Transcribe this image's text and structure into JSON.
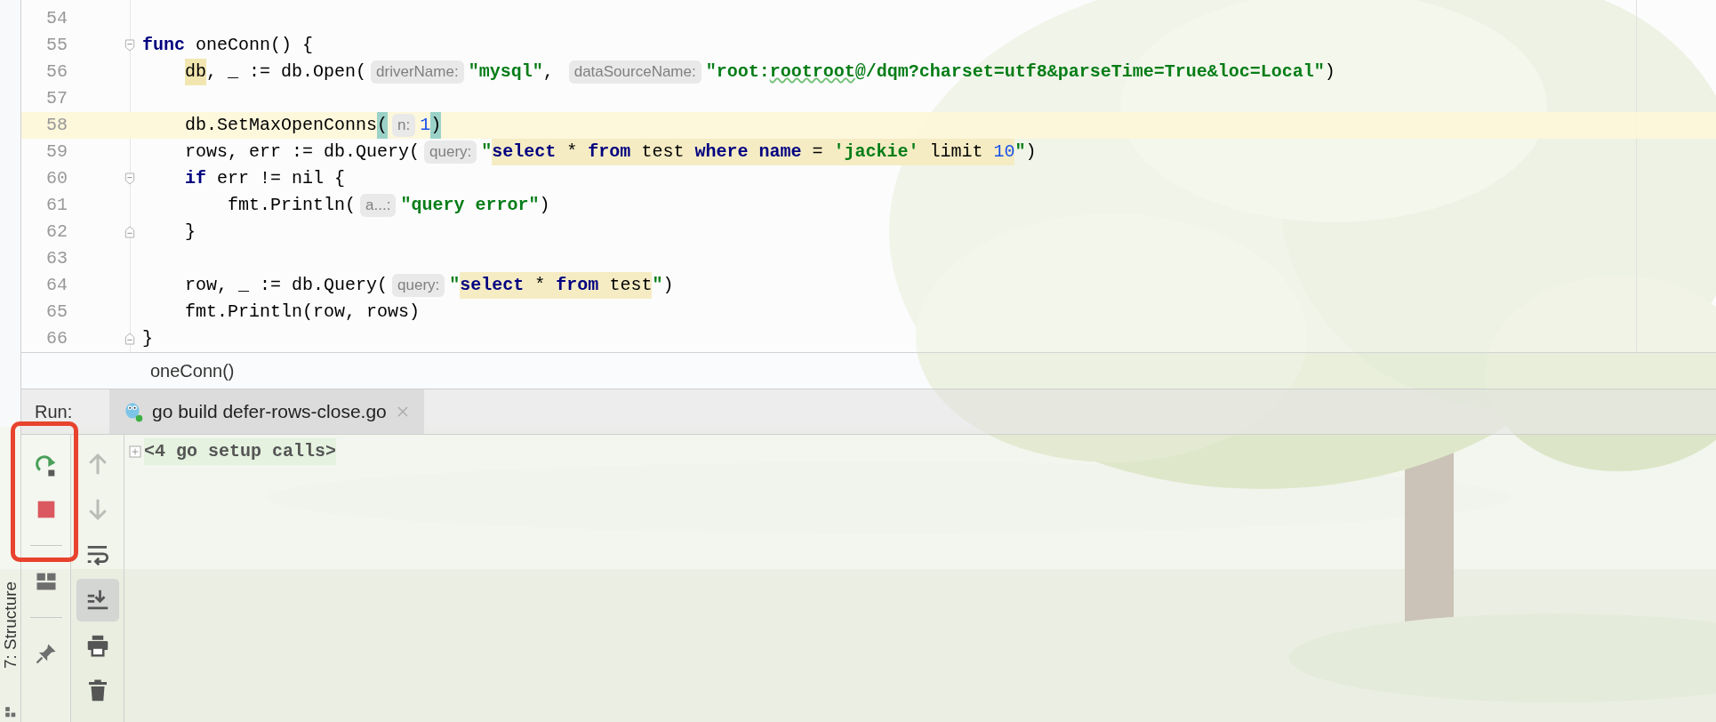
{
  "side_stripe": {
    "label": "7: Structure"
  },
  "editor": {
    "lines": [
      {
        "number": "54",
        "current": false,
        "fold_start": false,
        "fold_end": false
      },
      {
        "number": "55",
        "current": false,
        "fold_start": true,
        "fold_end": false,
        "tokens": [
          {
            "text": "func",
            "kind": "keyword"
          },
          {
            "text": " oneConn() {",
            "kind": "plain"
          }
        ]
      },
      {
        "number": "56",
        "current": false,
        "fold_start": false,
        "fold_end": false,
        "tokens": [
          {
            "text": "    db",
            "kind": "usage"
          },
          {
            "text": ", _ := db.Open(",
            "kind": "plain"
          },
          {
            "text": "driverName:",
            "kind": "hint"
          },
          {
            "text": "\"mysql\"",
            "kind": "string"
          },
          {
            "text": ", ",
            "kind": "plain"
          },
          {
            "text": "dataSourceName:",
            "kind": "hint"
          },
          {
            "text": "\"root:",
            "kind": "string"
          },
          {
            "text": "rootroot",
            "kind": "string_typo"
          },
          {
            "text": "@/dqm?charset=utf8&parseTime=True&loc=Local\"",
            "kind": "string"
          },
          {
            "text": ")",
            "kind": "plain"
          }
        ]
      },
      {
        "number": "57",
        "current": false,
        "fold_start": false,
        "fold_end": false
      },
      {
        "number": "58",
        "current": true,
        "fold_start": false,
        "fold_end": false,
        "tokens": [
          {
            "text": "    db.SetMaxOpenConns",
            "kind": "plain"
          },
          {
            "text": "(",
            "kind": "brace_match"
          },
          {
            "text": "n:",
            "kind": "hint"
          },
          {
            "text": "1",
            "kind": "number"
          },
          {
            "text": ")",
            "kind": "brace_match"
          }
        ]
      },
      {
        "number": "59",
        "current": false,
        "fold_start": false,
        "fold_end": false,
        "tokens": [
          {
            "text": "    rows, err := db.Query(",
            "kind": "plain"
          },
          {
            "text": "query:",
            "kind": "hint"
          },
          {
            "text": "\"",
            "kind": "string"
          },
          {
            "text": "select",
            "kind": "sql_keyword"
          },
          {
            "text": " * ",
            "kind": "sql_plain"
          },
          {
            "text": "from",
            "kind": "sql_keyword"
          },
          {
            "text": " test ",
            "kind": "sql_plain"
          },
          {
            "text": "where name",
            "kind": "sql_keyword"
          },
          {
            "text": " = ",
            "kind": "sql_plain"
          },
          {
            "text": "'jackie'",
            "kind": "sql_string"
          },
          {
            "text": " limit ",
            "kind": "sql_plain"
          },
          {
            "text": "10",
            "kind": "sql_number"
          },
          {
            "text": "\"",
            "kind": "string"
          },
          {
            "text": ")",
            "kind": "plain"
          }
        ]
      },
      {
        "number": "60",
        "current": false,
        "fold_start": true,
        "fold_end": false,
        "tokens": [
          {
            "text": "    if",
            "kind": "keyword"
          },
          {
            "text": " err != nil {",
            "kind": "plain"
          }
        ]
      },
      {
        "number": "61",
        "current": false,
        "fold_start": false,
        "fold_end": false,
        "tokens": [
          {
            "text": "        fmt.Println(",
            "kind": "plain"
          },
          {
            "text": "a...:",
            "kind": "hint"
          },
          {
            "text": "\"query error\"",
            "kind": "string"
          },
          {
            "text": ")",
            "kind": "plain"
          }
        ]
      },
      {
        "number": "62",
        "current": false,
        "fold_start": false,
        "fold_end": true,
        "tokens": [
          {
            "text": "    }",
            "kind": "plain"
          }
        ]
      },
      {
        "number": "63",
        "current": false,
        "fold_start": false,
        "fold_end": false
      },
      {
        "number": "64",
        "current": false,
        "fold_start": false,
        "fold_end": false,
        "tokens": [
          {
            "text": "    row, _ := db.Query(",
            "kind": "plain"
          },
          {
            "text": "query:",
            "kind": "hint"
          },
          {
            "text": "\"",
            "kind": "string"
          },
          {
            "text": "select",
            "kind": "sql_keyword"
          },
          {
            "text": " * ",
            "kind": "sql_plain"
          },
          {
            "text": "from",
            "kind": "sql_keyword"
          },
          {
            "text": " test",
            "kind": "sql_plain"
          },
          {
            "text": "\"",
            "kind": "string"
          },
          {
            "text": ")",
            "kind": "plain"
          }
        ]
      },
      {
        "number": "65",
        "current": false,
        "fold_start": false,
        "fold_end": false,
        "tokens": [
          {
            "text": "    fmt.Println(row, rows)",
            "kind": "plain"
          }
        ]
      },
      {
        "number": "66",
        "current": false,
        "fold_start": false,
        "fold_end": true,
        "tokens": [
          {
            "text": "}",
            "kind": "plain"
          }
        ]
      }
    ]
  },
  "breadcrumb": "oneConn()",
  "run_panel": {
    "label": "Run:",
    "tabs": [
      {
        "title": "go build defer-rows-close.go",
        "selected": true
      }
    ],
    "run_toolbar": [
      {
        "kind": "rerun"
      },
      {
        "kind": "stop"
      },
      {
        "kind": "separator"
      },
      {
        "kind": "layout"
      },
      {
        "kind": "separator"
      },
      {
        "kind": "pin"
      }
    ],
    "console_toolbar": [
      {
        "kind": "up",
        "disabled": true
      },
      {
        "kind": "down",
        "disabled": true
      },
      {
        "kind": "wrap",
        "disabled": false,
        "on": false
      },
      {
        "kind": "scroll_end",
        "disabled": false,
        "on": true
      },
      {
        "kind": "print",
        "disabled": false
      },
      {
        "kind": "trash",
        "disabled": false
      }
    ],
    "console": [
      {
        "text": "<4 go setup calls>",
        "kind": "folded"
      }
    ]
  },
  "highlight_frame": true
}
